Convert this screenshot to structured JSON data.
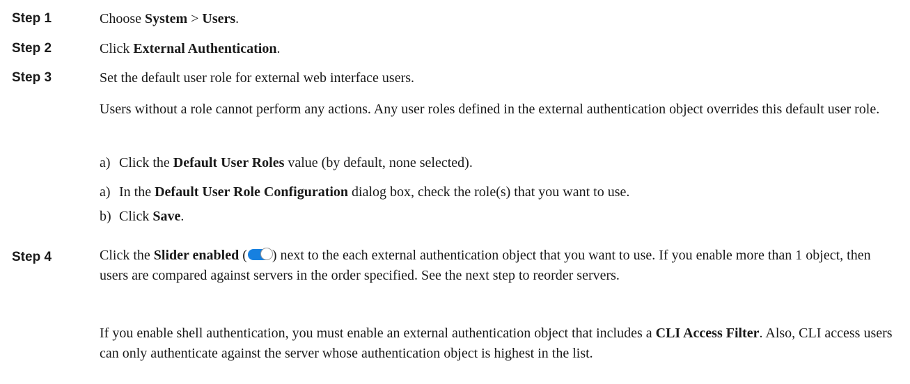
{
  "steps": [
    {
      "label": "Step 1",
      "segments": [
        {
          "text": "Choose ",
          "bold": false
        },
        {
          "text": "System",
          "bold": true
        },
        {
          "text": " >  ",
          "bold": false
        },
        {
          "text": "Users",
          "bold": true
        },
        {
          "text": ".",
          "bold": false
        }
      ]
    },
    {
      "label": "Step 2",
      "segments": [
        {
          "text": "Click ",
          "bold": false
        },
        {
          "text": "External Authentication",
          "bold": true
        },
        {
          "text": ".",
          "bold": false
        }
      ]
    },
    {
      "label": "Step 3",
      "text": "Set the default user role for external web interface users.",
      "note": "Users without a role cannot perform any actions. Any user roles defined in the external authentication object overrides this default user role.",
      "substeps": [
        {
          "marker": "a)",
          "segments": [
            {
              "text": "Click the ",
              "bold": false
            },
            {
              "text": "Default User Roles",
              "bold": true
            },
            {
              "text": " value (by default, none selected).",
              "bold": false
            }
          ]
        },
        {
          "marker": "a)",
          "segments": [
            {
              "text": "In the ",
              "bold": false
            },
            {
              "text": "Default User Role Configuration",
              "bold": true
            },
            {
              "text": " dialog box, check the role(s) that you want to use.",
              "bold": false
            }
          ]
        },
        {
          "marker": "b)",
          "segments": [
            {
              "text": "Click ",
              "bold": false
            },
            {
              "text": "Save",
              "bold": true
            },
            {
              "text": ".",
              "bold": false
            }
          ]
        }
      ]
    },
    {
      "label": "Step 4",
      "intro": "Click the ",
      "slider_label": "Slider enabled",
      "paren_open": " (",
      "paren_close": ")",
      "rest": " next to the each external authentication object that you want to use. If you enable more than 1 object, then users are compared against servers in the order specified. See the next step to reorder servers.",
      "note_segments": [
        {
          "text": "If you enable shell authentication, you must enable an external authentication object that includes a ",
          "bold": false
        },
        {
          "text": "CLI Access Filter",
          "bold": true
        },
        {
          "text": ". Also, CLI access users can only authenticate against the server whose authentication object is highest in the list.",
          "bold": false
        }
      ]
    }
  ],
  "icons": {
    "slider_icon": "toggle-switch-on-icon"
  },
  "colors": {
    "slider_on": "#1680e0"
  }
}
